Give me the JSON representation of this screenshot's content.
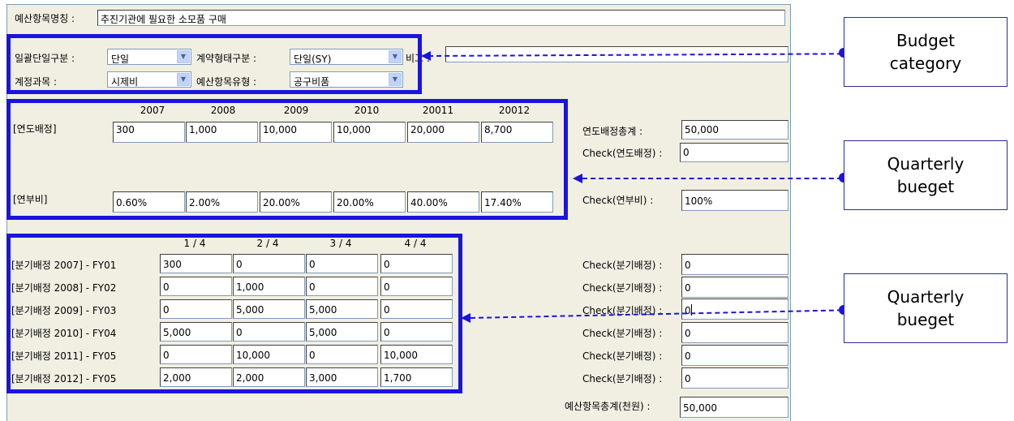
{
  "header": {
    "label": "예산항목명칭 :",
    "value": "추진기관에 필요한 소모품 구매"
  },
  "category": {
    "lump_label": "일괄단일구분 :",
    "lump_value": "단일",
    "contract_label": "계약형태구분 :",
    "contract_value": "단일(SY)",
    "note_label": "비고 :",
    "account_label": "계정과목 :",
    "account_value": "시제비",
    "budget_type_label": "예산항목유형 :",
    "budget_type_value": "공구비품"
  },
  "yearly": {
    "years": [
      "2007",
      "2008",
      "2009",
      "2010",
      "20011",
      "20012"
    ],
    "alloc_label": "[연도배정]",
    "alloc_values": [
      "300",
      "1,000",
      "10,000",
      "10,000",
      "20,000",
      "8,700"
    ],
    "rate_label": "[연부비]",
    "rate_values": [
      "0.60%",
      "2.00%",
      "20.00%",
      "20.00%",
      "40.00%",
      "17.40%"
    ],
    "total_label": "연도배정총계 :",
    "total_value": "50,000",
    "check_alloc_label": "Check(연도배정) :",
    "check_alloc_value": "0",
    "check_rate_label": "Check(연부비) :",
    "check_rate_value": "100%"
  },
  "quarterly": {
    "quarters": [
      "1 / 4",
      "2 / 4",
      "3 / 4",
      "4 / 4"
    ],
    "rows": [
      {
        "label": "[분기배정 2007] - FY01",
        "values": [
          "300",
          "0",
          "0",
          "0"
        ],
        "check_label": "Check(분기배정) :",
        "check_value": "0"
      },
      {
        "label": "[분기배정 2008] - FY02",
        "values": [
          "0",
          "1,000",
          "0",
          "0"
        ],
        "check_label": "Check(분기배정) :",
        "check_value": "0"
      },
      {
        "label": "[분기배정 2009] - FY03",
        "values": [
          "0",
          "5,000",
          "5,000",
          "0"
        ],
        "check_label": "Check(분기배정) :",
        "check_value": "0"
      },
      {
        "label": "[분기배정 2010] - FY04",
        "values": [
          "5,000",
          "0",
          "5,000",
          "0"
        ],
        "check_label": "Check(분기배정) :",
        "check_value": "0"
      },
      {
        "label": "[분기배정 2011] - FY05",
        "values": [
          "0",
          "10,000",
          "0",
          "10,000"
        ],
        "check_label": "Check(분기배정) :",
        "check_value": "0"
      },
      {
        "label": "[분기배정 2012] - FY05",
        "values": [
          "2,000",
          "2,000",
          "3,000",
          "1,700"
        ],
        "check_label": "Check(분기배정) :",
        "check_value": "0"
      }
    ],
    "total_label": "예산항목총계(천원) :",
    "total_value": "50,000"
  },
  "callouts": {
    "budget_category": [
      "Budget",
      "category"
    ],
    "quarterly_1": [
      "Quarterly",
      "bueget"
    ],
    "quarterly_2": [
      "Quarterly",
      "bueget"
    ]
  },
  "colors": {
    "highlight": "#1a14e0",
    "panel": "#f1efe2",
    "field_border": "#7f9db9"
  }
}
